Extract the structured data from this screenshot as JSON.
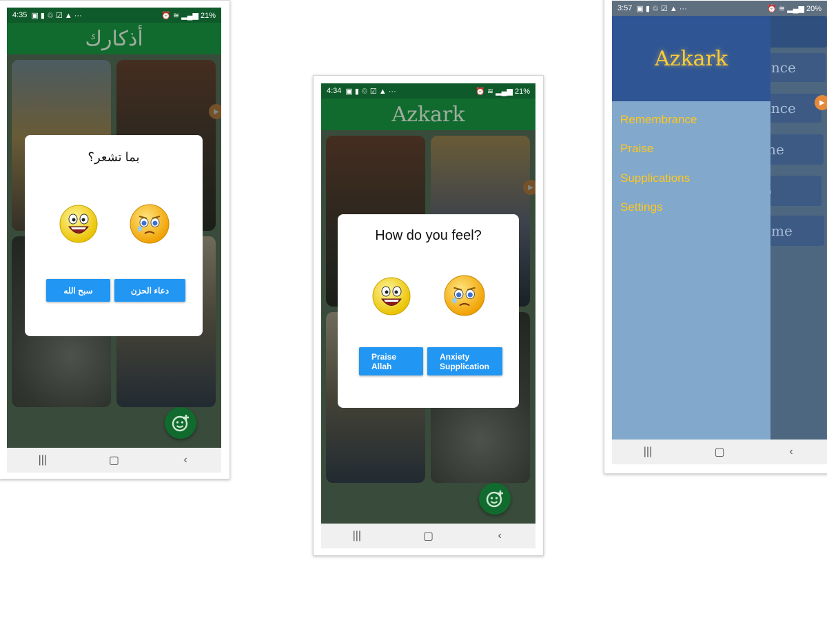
{
  "screen_left": {
    "status": {
      "time": "4:35",
      "battery": "21%"
    },
    "app_title": "أذكارك",
    "dialog": {
      "title": "بما تشعر؟",
      "happy_emoji_icon": "happy-emoji-icon",
      "sad_emoji_icon": "sad-emoji-icon",
      "buttons": [
        "سبح الله",
        "دعاء الحزن"
      ]
    }
  },
  "screen_middle": {
    "status": {
      "time": "4:34",
      "battery": "21%"
    },
    "app_title": "Azkark",
    "dialog": {
      "title": "How do you feel?",
      "happy_emoji_icon": "happy-emoji-icon",
      "sad_emoji_icon": "sad-emoji-icon",
      "buttons": [
        {
          "line1": "Praise",
          "line2": "Allah"
        },
        {
          "line1": "Anxiety",
          "line2": "Supplication"
        }
      ]
    }
  },
  "screen_right": {
    "status": {
      "time": "3:57",
      "battery": "20%"
    },
    "drawer": {
      "title": "Azkark",
      "items": [
        "Remembrance",
        "Praise",
        "Supplications",
        "Settings"
      ]
    },
    "background_cards": [
      "ance",
      "ance",
      "me",
      "p",
      "ome"
    ]
  },
  "colors": {
    "appbar": "#116b2e",
    "button": "#2196f3",
    "drawer_header": "#2f5594",
    "drawer_body": "#82a8cb",
    "drawer_text": "#ffc81e"
  }
}
